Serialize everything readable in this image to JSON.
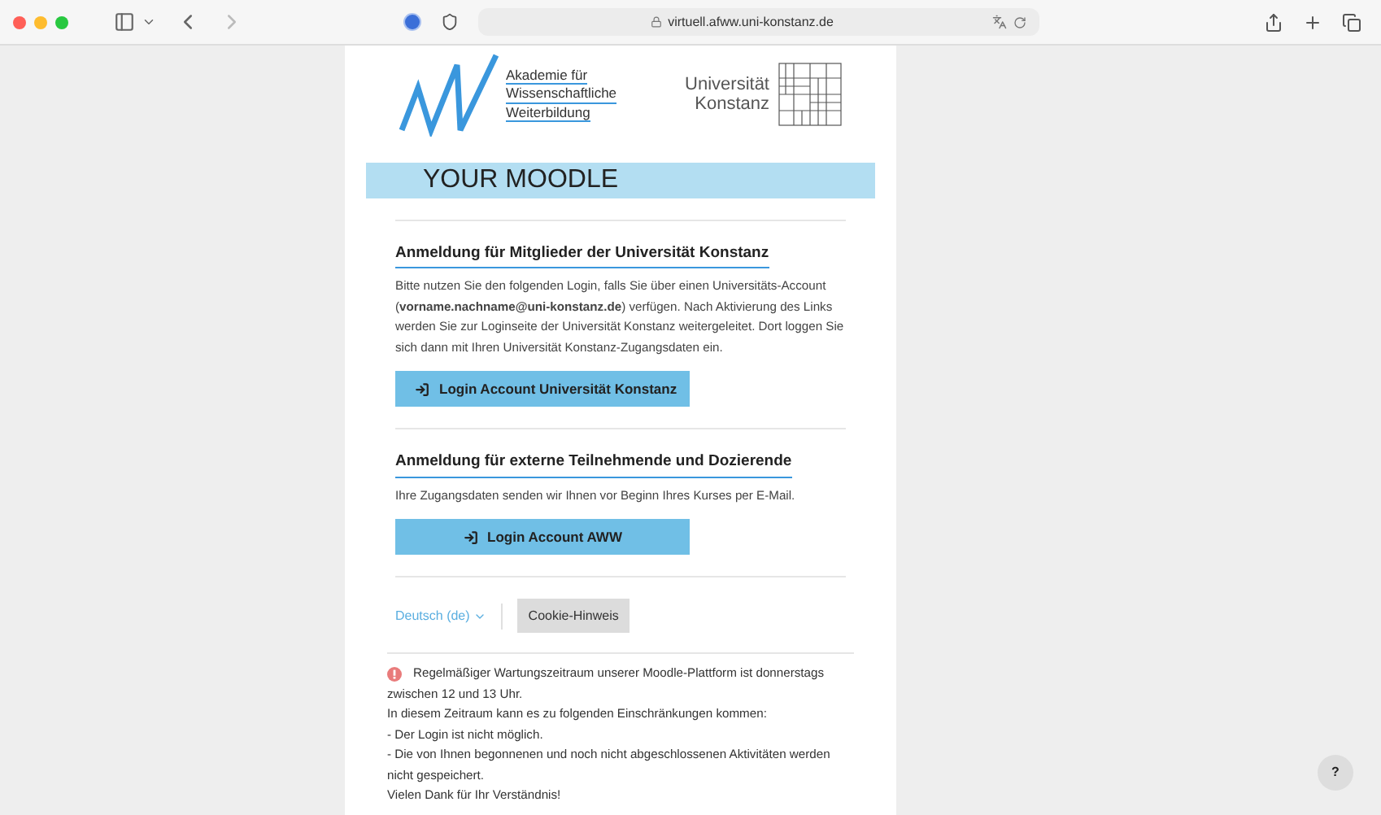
{
  "browser": {
    "url": "virtuell.afww.uni-konstanz.de"
  },
  "header": {
    "academy_lines": [
      "Akademie für",
      "Wissenschaftliche",
      "Weiterbildung"
    ],
    "university_lines": [
      "Universität",
      "Konstanz"
    ]
  },
  "banner": "YOUR MOODLE",
  "sections": [
    {
      "heading": "Anmeldung für Mitglieder der Universität Konstanz",
      "text": "Bitte nutzen Sie den folgenden Login, falls Sie über einen Universitäts-Account (**vorname.nachname@uni-konstanz.de**) verfügen. Nach Aktivierung des Links werden Sie zur Loginseite der Universität Konstanz weitergeleitet. Dort loggen Sie sich dann mit Ihren Universität Konstanz-Zugangsdaten ein.",
      "button": "Login Account Universität Konstanz",
      "kind": "university"
    },
    {
      "heading": "Anmeldung für externe Teilnehmende und Dozierende",
      "text": "Ihre Zugangsdaten senden wir Ihnen vor Beginn Ihres Kurses per E-Mail.",
      "button": "Login Account AWW",
      "kind": "external"
    }
  ],
  "footer": {
    "language": "Deutsch (de)",
    "cookie_button": "Cookie-Hinweis"
  },
  "notice": [
    "Regelmäßiger Wartungszeitraum unserer Moodle-Plattform ist donnerstags zwischen 12 und 13 Uhr.",
    "In diesem Zeitraum kann es zu folgenden Einschränkungen kommen:",
    "- Der Login ist nicht möglich.",
    "- Die von Ihnen begonnenen und noch nicht abgeschlossenen Aktivitäten werden nicht gespeichert.",
    "Vielen Dank für Ihr Verständnis!"
  ],
  "help_button": "?"
}
